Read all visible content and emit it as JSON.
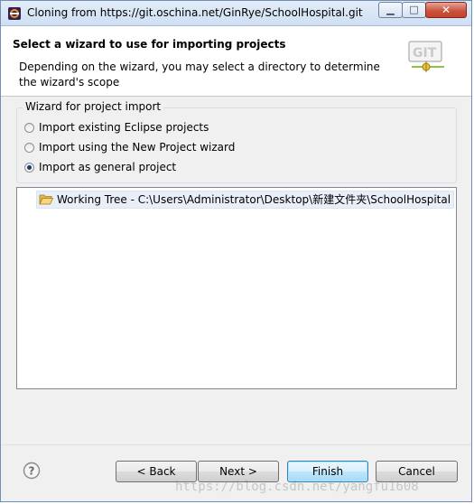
{
  "window": {
    "title": "Cloning from https://git.oschina.net/GinRye/SchoolHospital.git",
    "app_icon": "eclipse-icon",
    "controls": {
      "minimize_icon": "minimize-icon",
      "maximize_icon": "maximize-icon",
      "close_icon": "close-icon",
      "minimize_glyph": "▁",
      "maximize_glyph": "□",
      "close_glyph": "✕"
    }
  },
  "header": {
    "title": "Select a wizard to use for importing projects",
    "description": "Depending on the wizard, you may select a directory to determine the wizard's scope",
    "logo_text": "GIT"
  },
  "wizard_group": {
    "label": "Wizard for project import",
    "options": [
      {
        "label": "Import existing Eclipse projects",
        "selected": false
      },
      {
        "label": "Import using the New Project wizard",
        "selected": false
      },
      {
        "label": "Import as general project",
        "selected": true
      }
    ]
  },
  "tree": {
    "items": [
      {
        "icon": "folder-open-icon",
        "label": "Working Tree - C:\\Users\\Administrator\\Desktop\\新建文件夹\\SchoolHospital",
        "selected": true
      }
    ]
  },
  "footer": {
    "help_icon": "help-icon",
    "buttons": {
      "back": "< Back",
      "next": "Next >",
      "finish": "Finish",
      "cancel": "Cancel"
    }
  },
  "watermark": "https://blog.csdn.net/yangfu1608",
  "colors": {
    "titlebar": "#cfdff3",
    "dialog_bg": "#f0f0f0",
    "selection": "#e8eff8",
    "default_button_border": "#3c7fb1"
  }
}
